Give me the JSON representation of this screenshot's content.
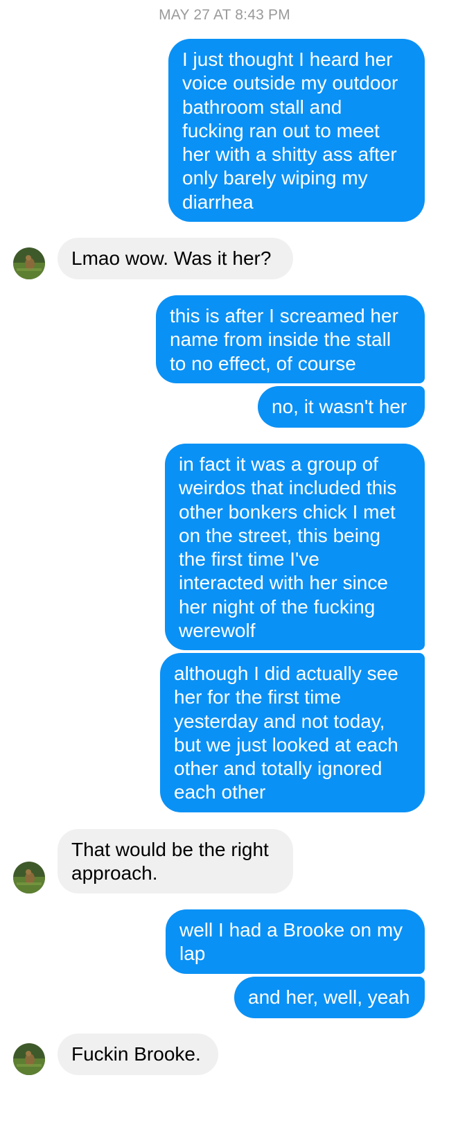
{
  "thread": {
    "timestamp": "MAY 27 AT 8:43 PM",
    "messages": [
      {
        "id": "m1",
        "direction": "outgoing",
        "text": "I just thought I heard her\nvoice outside my outdoor\nbathroom stall and\nfucking ran out to meet\nher with a shitty ass after\nonly barely wiping my\ndiarrhea"
      },
      {
        "id": "m2",
        "direction": "incoming",
        "text": "Lmao wow. Was it her?"
      },
      {
        "id": "m3",
        "direction": "outgoing",
        "text": "this is after I screamed her\nname from inside the stall\nto no effect, of course"
      },
      {
        "id": "m4",
        "direction": "outgoing",
        "text": "no, it wasn't her"
      },
      {
        "id": "m5",
        "direction": "outgoing",
        "text": "in fact it was a group of\nweirdos that included this\nother bonkers chick I met\non the street, this being\nthe first time I've\ninteracted with her since\nher night of the fucking\nwerewolf"
      },
      {
        "id": "m6",
        "direction": "outgoing",
        "text": "although I did actually see\nher for the first time\nyesterday and not today,\nbut we just looked at each\nother and totally ignored\neach other"
      },
      {
        "id": "m7",
        "direction": "incoming",
        "text": "That would be the right\napproach."
      },
      {
        "id": "m8",
        "direction": "outgoing",
        "text": "well I had a Brooke on my\nlap"
      },
      {
        "id": "m9",
        "direction": "outgoing",
        "text": "and her, well, yeah"
      },
      {
        "id": "m10",
        "direction": "incoming",
        "text": "Fuckin Brooke."
      }
    ]
  },
  "colors": {
    "outgoing_bubble": "#0a91f5",
    "incoming_bubble": "#f1f0f0",
    "timestamp_text": "#9a9a9a"
  },
  "icons": {
    "avatar": "contact-avatar-photo"
  }
}
